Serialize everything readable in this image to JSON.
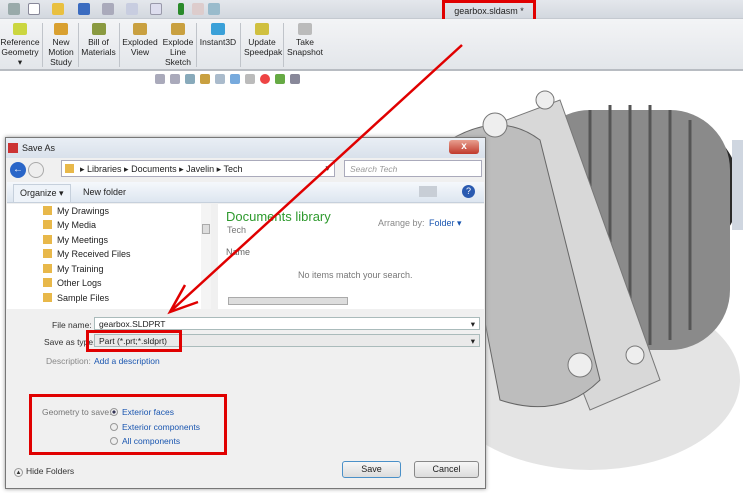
{
  "window": {
    "document_title": "gearbox.sldasm *"
  },
  "ribbon": {
    "buttons": [
      {
        "label": "Reference Geometry",
        "icon": "reference-geometry-icon"
      },
      {
        "label": "New Motion Study",
        "icon": "motion-study-icon"
      },
      {
        "label": "Bill of Materials",
        "icon": "bom-icon"
      },
      {
        "label": "Exploded View",
        "icon": "exploded-view-icon"
      },
      {
        "label": "Explode Line Sketch",
        "icon": "explode-line-icon"
      },
      {
        "label": "Instant3D",
        "icon": "instant3d-icon"
      },
      {
        "label": "Update Speedpak",
        "icon": "speedpak-icon"
      },
      {
        "label": "Take Snapshot",
        "icon": "snapshot-icon"
      }
    ]
  },
  "dialog": {
    "title": "Save As",
    "close": "x",
    "breadcrumb": [
      "Libraries",
      "Documents",
      "Javelin",
      "Tech"
    ],
    "search_placeholder": "Search Tech",
    "organize": "Organize ▾",
    "new_folder": "New folder",
    "folders": [
      "My Drawings",
      "My Media",
      "My Meetings",
      "My Received Files",
      "My Training",
      "Other Logs",
      "Sample Files"
    ],
    "library_title": "Documents library",
    "library_sub": "Tech",
    "arrange_label": "Arrange by:",
    "arrange_value": "Folder ▾",
    "column_name": "Name",
    "empty_message": "No items match your search.",
    "file_name_label": "File name:",
    "file_name_value": "gearbox.SLDPRT",
    "save_type_label": "Save as type:",
    "save_type_value": "Part (*.prt;*.sldprt)",
    "description_label": "Description:",
    "description_link": "Add a description",
    "geometry_label": "Geometry to save:",
    "geometry_options": [
      {
        "label": "Exterior faces",
        "selected": true
      },
      {
        "label": "Exterior components",
        "selected": false
      },
      {
        "label": "All components",
        "selected": false
      }
    ],
    "hide_folders": "Hide Folders",
    "save": "Save",
    "cancel": "Cancel"
  },
  "colors": {
    "annotation": "#e00000",
    "link": "#1a56b0",
    "library_title": "#2e9a2e"
  }
}
